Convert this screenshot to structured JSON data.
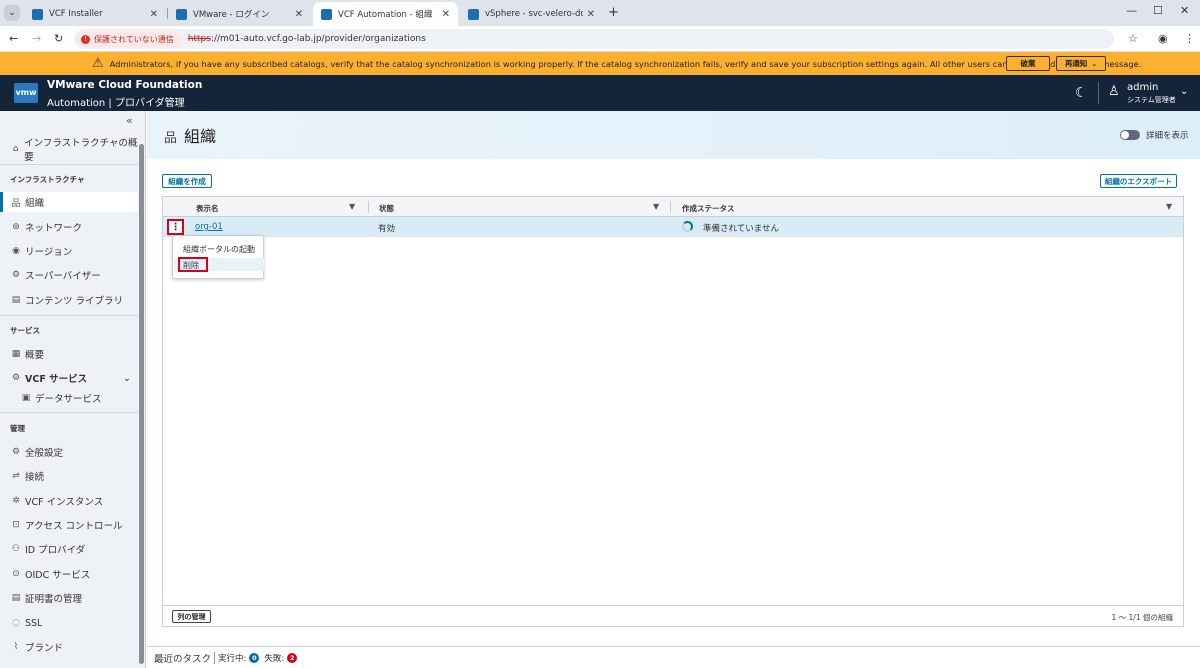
{
  "browser": {
    "tabs": [
      {
        "title": "VCF Installer"
      },
      {
        "title": "VMware - ログイン"
      },
      {
        "title": "VCF Automation - 組織"
      },
      {
        "title": "vSphere - svc-velero-domain-c"
      }
    ],
    "warning_label": "保護されていない通信",
    "url_scheme": "https",
    "url_rest": "://m01-auto.vcf.go-lab.jp/provider/organizations"
  },
  "banner": {
    "message": "Administrators, if you have any subscribed catalogs, verify that the catalog synchronization is working properly. If the catalog synchronization fails, verify and save your subscription settings again. All other users can ignore or dismiss this message.",
    "dismiss_label": "破棄",
    "remind_label": "再通知"
  },
  "header": {
    "logo": "vmw",
    "title": "VMware Cloud Foundation",
    "subtitle": "Automation | プロバイダ管理",
    "user_name": "admin",
    "user_role": "システム管理者"
  },
  "sidebar": {
    "overview": "インフラストラクチャの概要",
    "infra_heading": "インフラストラクチャ",
    "infra_items": [
      "組織",
      "ネットワーク",
      "リージョン",
      "スーパーバイザー",
      "コンテンツ ライブラリ"
    ],
    "services_heading": "サービス",
    "services_items": [
      "概要",
      "VCF サービス",
      "データサービス"
    ],
    "admin_heading": "管理",
    "admin_items": [
      "全般設定",
      "接続",
      "VCF インスタンス",
      "アクセス コントロール",
      "ID プロバイダ",
      "OIDC サービス",
      "証明書の管理",
      "SSL",
      "ブランド"
    ]
  },
  "page": {
    "title": "組織",
    "details_toggle_label": "詳細を表示",
    "create_button": "組織を作成",
    "export_button": "組織のエクスポート"
  },
  "grid": {
    "columns": [
      "表示名",
      "状態",
      "作成ステータス"
    ],
    "rows": [
      {
        "name": "org-01",
        "state": "有効",
        "status": "準備されていません"
      }
    ],
    "menu_items": [
      "組織ポータルの起動",
      "削除"
    ],
    "column_manager": "列の管理",
    "footer_count": "1 ～ 1/1 個の組織"
  },
  "taskbar": {
    "title": "最近のタスク",
    "running_label": "実行中:",
    "running_count": "0",
    "failed_label": "失敗:",
    "failed_count": "2"
  },
  "colors": {
    "banner": "#fcb030",
    "header": "#14253a",
    "accent": "#0072a3",
    "highlight_box": "#d6001c"
  }
}
